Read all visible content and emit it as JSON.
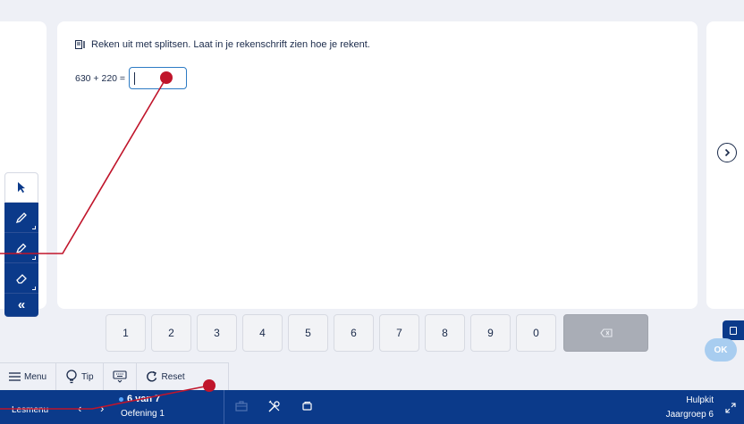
{
  "question": {
    "instruction": "Reken uit met splitsen. Laat in je rekenschrift zien hoe je rekent.",
    "expression": "630 + 220 =",
    "answer_value": "",
    "instruction_icon": "worksheet-icon"
  },
  "navigation": {
    "next_icon": "chevron-right-circle-icon"
  },
  "tools": [
    {
      "name": "select",
      "icon": "cursor-arrow-icon"
    },
    {
      "name": "pencil",
      "icon": "pencil-icon"
    },
    {
      "name": "marker",
      "icon": "marker-icon"
    },
    {
      "name": "eraser",
      "icon": "eraser-icon"
    },
    {
      "name": "collapse",
      "label": "«"
    }
  ],
  "keypad": {
    "keys": [
      "1",
      "2",
      "3",
      "4",
      "5",
      "6",
      "7",
      "8",
      "9",
      "0"
    ],
    "backspace": "⌫"
  },
  "action_bar": {
    "menu_label": "Menu",
    "tip_label": "Tip",
    "keyboard_icon": "keyboard-icon",
    "reset_label": "Reset"
  },
  "ok_label": "OK",
  "bottom_bar": {
    "lesmenu_label": "Lesmenu",
    "prev": "‹",
    "next": "›",
    "progress_label": "6 van 7",
    "exercise_label": "Oefening 1",
    "hulpkit_label": "Hulpkit",
    "grade_label": "Jaargroep 6"
  },
  "colors": {
    "primary": "#0b3a8a",
    "accent": "#2d7bc4",
    "annotation": "#c0152b",
    "background": "#eef0f6"
  }
}
